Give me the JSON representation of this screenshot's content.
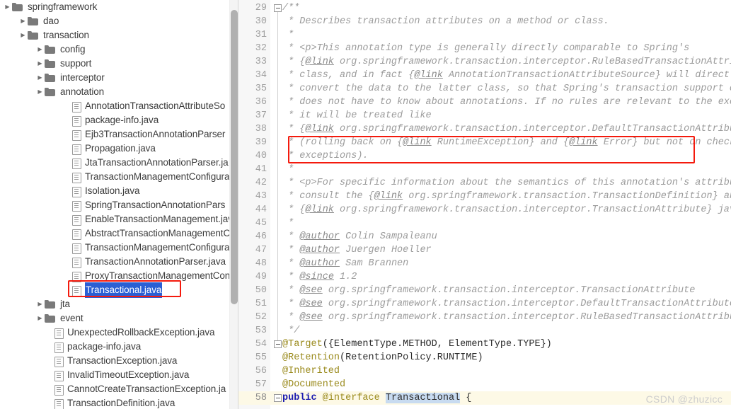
{
  "file_tree": {
    "name": "project-file-tree",
    "selected": "Transactional.java",
    "items": [
      {
        "label": "springframework",
        "type": "folder",
        "level": 0,
        "arrow": "collapsed"
      },
      {
        "label": "dao",
        "type": "folder",
        "level": 1,
        "arrow": "collapsed"
      },
      {
        "label": "transaction",
        "type": "folder",
        "level": 1,
        "arrow": "collapsed"
      },
      {
        "label": "config",
        "type": "folder",
        "level": 2,
        "arrow": "collapsed"
      },
      {
        "label": "support",
        "type": "folder",
        "level": 2,
        "arrow": "collapsed"
      },
      {
        "label": "interceptor",
        "type": "folder",
        "level": 2,
        "arrow": "collapsed"
      },
      {
        "label": "annotation",
        "type": "folder",
        "level": 2,
        "arrow": "collapsed"
      },
      {
        "label": "AnnotationTransactionAttributeSo",
        "type": "file",
        "level": 3,
        "arrow": "none"
      },
      {
        "label": "package-info.java",
        "type": "file",
        "level": 3,
        "arrow": "none"
      },
      {
        "label": "Ejb3TransactionAnnotationParser",
        "type": "file",
        "level": 3,
        "arrow": "none"
      },
      {
        "label": "Propagation.java",
        "type": "file",
        "level": 3,
        "arrow": "none"
      },
      {
        "label": "JtaTransactionAnnotationParser.ja",
        "type": "file",
        "level": 3,
        "arrow": "none"
      },
      {
        "label": "TransactionManagementConfigura",
        "type": "file",
        "level": 3,
        "arrow": "none"
      },
      {
        "label": "Isolation.java",
        "type": "file",
        "level": 3,
        "arrow": "none"
      },
      {
        "label": "SpringTransactionAnnotationPars",
        "type": "file",
        "level": 3,
        "arrow": "none"
      },
      {
        "label": "EnableTransactionManagement.jav",
        "type": "file",
        "level": 3,
        "arrow": "none"
      },
      {
        "label": "AbstractTransactionManagementC",
        "type": "file",
        "level": 3,
        "arrow": "none"
      },
      {
        "label": "TransactionManagementConfigura",
        "type": "file",
        "level": 3,
        "arrow": "none"
      },
      {
        "label": "TransactionAnnotationParser.java",
        "type": "file",
        "level": 3,
        "arrow": "none"
      },
      {
        "label": "ProxyTransactionManagementCon",
        "type": "file",
        "level": 3,
        "arrow": "none"
      },
      {
        "label": "Transactional.java",
        "type": "file",
        "level": 3,
        "arrow": "none",
        "selected": true
      },
      {
        "label": "jta",
        "type": "folder",
        "level": 2,
        "arrow": "collapsed"
      },
      {
        "label": "event",
        "type": "folder",
        "level": 2,
        "arrow": "collapsed"
      },
      {
        "label": "UnexpectedRollbackException.java",
        "type": "file",
        "level": 2,
        "arrow": "none"
      },
      {
        "label": "package-info.java",
        "type": "file",
        "level": 2,
        "arrow": "none"
      },
      {
        "label": "TransactionException.java",
        "type": "file",
        "level": 2,
        "arrow": "none"
      },
      {
        "label": "InvalidTimeoutException.java",
        "type": "file",
        "level": 2,
        "arrow": "none"
      },
      {
        "label": "CannotCreateTransactionException.ja",
        "type": "file",
        "level": 2,
        "arrow": "none"
      },
      {
        "label": "TransactionDefinition.java",
        "type": "file",
        "level": 2,
        "arrow": "none"
      }
    ]
  },
  "editor": {
    "first_line_number": 29,
    "last_line_number": 58,
    "current_line": 58,
    "fold_lines": [
      29,
      54,
      58
    ],
    "lines": [
      {
        "n": 29,
        "html": "<span class=\"cmt\">/**</span>"
      },
      {
        "n": 30,
        "html": "<span class=\"cmt\"> * Describes transaction attributes on a method or class.</span>"
      },
      {
        "n": 31,
        "html": "<span class=\"cmt\"> *</span>"
      },
      {
        "n": 32,
        "html": "<span class=\"cmt\"> * &lt;p&gt;This annotation type is generally directly comparable to Spring's</span>"
      },
      {
        "n": 33,
        "html": "<span class=\"cmt\"> * {<span class=\"tag\">@link</span> org.springframework.transaction.interceptor.RuleBasedTransactionAttribute}</span>"
      },
      {
        "n": 34,
        "html": "<span class=\"cmt\"> * class, and in fact {<span class=\"tag\">@link</span> AnnotationTransactionAttributeSource} will directly</span>"
      },
      {
        "n": 35,
        "html": "<span class=\"cmt\"> * convert the data to the latter class, so that Spring's transaction support code</span>"
      },
      {
        "n": 36,
        "html": "<span class=\"cmt\"> * does not have to know about annotations. If no rules are relevant to the exception,</span>"
      },
      {
        "n": 37,
        "html": "<span class=\"cmt\"> * it will be treated like</span>"
      },
      {
        "n": 38,
        "html": "<span class=\"cmt\"> * {<span class=\"tag\">@link</span> org.springframework.transaction.interceptor.DefaultTransactionAttribute}</span>"
      },
      {
        "n": 39,
        "html": "<span class=\"cmt\"> * (rolling back on {<span class=\"tag\">@link</span> RuntimeException} and {<span class=\"tag\">@link</span> Error} but not on checked</span>"
      },
      {
        "n": 40,
        "html": "<span class=\"cmt\"> * exceptions).</span>"
      },
      {
        "n": 41,
        "html": "<span class=\"cmt\"> *</span>"
      },
      {
        "n": 42,
        "html": "<span class=\"cmt\"> * &lt;p&gt;For specific information about the semantics of this annotation's attributes,</span>"
      },
      {
        "n": 43,
        "html": "<span class=\"cmt\"> * consult the {<span class=\"tag\">@link</span> org.springframework.transaction.TransactionDefinition} and</span>"
      },
      {
        "n": 44,
        "html": "<span class=\"cmt\"> * {<span class=\"tag\">@link</span> org.springframework.transaction.interceptor.TransactionAttribute} javadocs.</span>"
      },
      {
        "n": 45,
        "html": "<span class=\"cmt\"> *</span>"
      },
      {
        "n": 46,
        "html": "<span class=\"cmt\"> * <span class=\"tag\">@author</span> Colin Sampaleanu</span>"
      },
      {
        "n": 47,
        "html": "<span class=\"cmt\"> * <span class=\"tag\">@author</span> Juergen Hoeller</span>"
      },
      {
        "n": 48,
        "html": "<span class=\"cmt\"> * <span class=\"tag\">@author</span> Sam Brannen</span>"
      },
      {
        "n": 49,
        "html": "<span class=\"cmt\"> * <span class=\"tag\">@since</span> 1.2</span>"
      },
      {
        "n": 50,
        "html": "<span class=\"cmt\"> * <span class=\"tag\">@see</span> org.springframework.transaction.interceptor.TransactionAttribute</span>"
      },
      {
        "n": 51,
        "html": "<span class=\"cmt\"> * <span class=\"tag\">@see</span> org.springframework.transaction.interceptor.DefaultTransactionAttribute</span>"
      },
      {
        "n": 52,
        "html": "<span class=\"cmt\"> * <span class=\"tag\">@see</span> org.springframework.transaction.interceptor.RuleBasedTransactionAttribute</span>"
      },
      {
        "n": 53,
        "html": "<span class=\"cmt\"> */</span>"
      },
      {
        "n": 54,
        "html": "<span class=\"anno\">@Target</span><span class=\"plain\">({ElementType.METHOD, ElementType.TYPE})</span>"
      },
      {
        "n": 55,
        "html": "<span class=\"anno\">@Retention</span><span class=\"plain\">(RetentionPolicy.RUNTIME)</span>"
      },
      {
        "n": 56,
        "html": "<span class=\"anno\">@Inherited</span>"
      },
      {
        "n": 57,
        "html": "<span class=\"anno\">@Documented</span>"
      },
      {
        "n": 58,
        "html": "<span class=\"kw\">public</span><span class=\"plain\"> </span><span class=\"anno\">@interface</span><span class=\"plain\"> </span><span class=\"ident-hl\">Transactional</span><span class=\"plain\"> {</span>"
      }
    ],
    "code_text": [
      "/**",
      " * Describes transaction attributes on a method or class.",
      " *",
      " * <p>This annotation type is generally directly comparable to Spring's",
      " * {@link org.springframework.transaction.interceptor.RuleBasedTransactionAttribute}",
      " * class, and in fact {@link AnnotationTransactionAttributeSource} will directly",
      " * convert the data to the latter class, so that Spring's transaction support code",
      " * does not have to know about annotations. If no rules are relevant to the exception,",
      " * it will be treated like",
      " * {@link org.springframework.transaction.interceptor.DefaultTransactionAttribute}",
      " * (rolling back on {@link RuntimeException} and {@link Error} but not on checked",
      " * exceptions).",
      " *",
      " * <p>For specific information about the semantics of this annotation's attributes,",
      " * consult the {@link org.springframework.transaction.TransactionDefinition} and",
      " * {@link org.springframework.transaction.interceptor.TransactionAttribute} javadocs.",
      " *",
      " * @author Colin Sampaleanu",
      " * @author Juergen Hoeller",
      " * @author Sam Brannen",
      " * @since 1.2",
      " * @see org.springframework.transaction.interceptor.TransactionAttribute",
      " * @see org.springframework.transaction.interceptor.DefaultTransactionAttribute",
      " * @see org.springframework.transaction.interceptor.RuleBasedTransactionAttribute",
      " */",
      "@Target({ElementType.METHOD, ElementType.TYPE})",
      "@Retention(RetentionPolicy.RUNTIME)",
      "@Inherited",
      "@Documented",
      "public @interface Transactional {"
    ]
  },
  "annotations": {
    "code_box_lines": "39-40",
    "tree_box_target": "Transactional.java",
    "box_color": "#f41a0d"
  },
  "watermark": {
    "text": "CSDN @zhuzicc"
  },
  "colors": {
    "selection_blue": "#2a5fd4",
    "comment_gray": "#9b9b9b",
    "annotation_olive": "#9a8a1c",
    "keyword_blue": "#1b1bb0",
    "identifier_highlight": "#c8dbf0",
    "current_line_bg": "#fdf9e6",
    "gutter_bg": "#f7f7f7"
  }
}
